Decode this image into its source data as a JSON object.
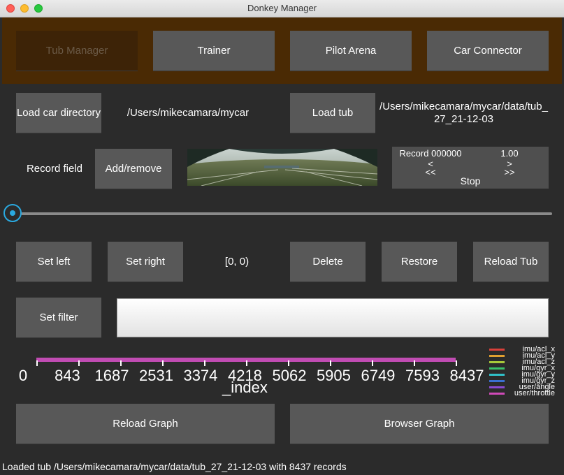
{
  "window": {
    "title": "Donkey Manager"
  },
  "tabs": [
    {
      "label": "Tub Manager"
    },
    {
      "label": "Trainer"
    },
    {
      "label": "Pilot Arena"
    },
    {
      "label": "Car Connector"
    }
  ],
  "car": {
    "load_label": "Load car directory",
    "path": "/Users/mikecamara/mycar"
  },
  "tub": {
    "load_label": "Load tub",
    "path": "/Users/mikecamara/mycar/data/tub_27_21-12-03"
  },
  "record_field": {
    "label": "Record field",
    "button_label": "Add/remove"
  },
  "controls": {
    "record": "Record 000000",
    "speed": "1.00",
    "prev": "<",
    "prev_fast": "<<",
    "next": ">",
    "next_fast": ">>",
    "stop": "Stop"
  },
  "slider": {
    "position_fraction": 0.0
  },
  "selection": {
    "set_left": "Set left",
    "set_right": "Set right",
    "range": "[0, 0)",
    "delete": "Delete",
    "restore": "Restore",
    "reload_tub": "Reload Tub"
  },
  "filter": {
    "button_label": "Set filter",
    "value": ""
  },
  "chart_data": {
    "type": "line",
    "xlabel": "_index",
    "xlim": [
      0,
      8437
    ],
    "xticks": [
      "0",
      "843",
      "1687",
      "2531",
      "3374",
      "4218",
      "5062",
      "5905",
      "6749",
      "7593",
      "8437"
    ],
    "series": [
      {
        "name": "imu/acl_x",
        "color": "#d9403a"
      },
      {
        "name": "imu/acl_y",
        "color": "#e0a030"
      },
      {
        "name": "imu/acl_z",
        "color": "#a8c83a"
      },
      {
        "name": "imu/gyr_x",
        "color": "#3ac06a"
      },
      {
        "name": "imu/gyr_y",
        "color": "#30c0c8"
      },
      {
        "name": "imu/gyr_z",
        "color": "#3a70d0"
      },
      {
        "name": "user/angle",
        "color": "#8a4ad0"
      },
      {
        "name": "user/throttle",
        "color": "#d04ab8"
      }
    ],
    "legend": "right"
  },
  "graph_buttons": {
    "reload": "Reload Graph",
    "browser": "Browser Graph"
  },
  "status": "Loaded tub /Users/mikecamara/mycar/data/tub_27_21-12-03 with 8437 records"
}
